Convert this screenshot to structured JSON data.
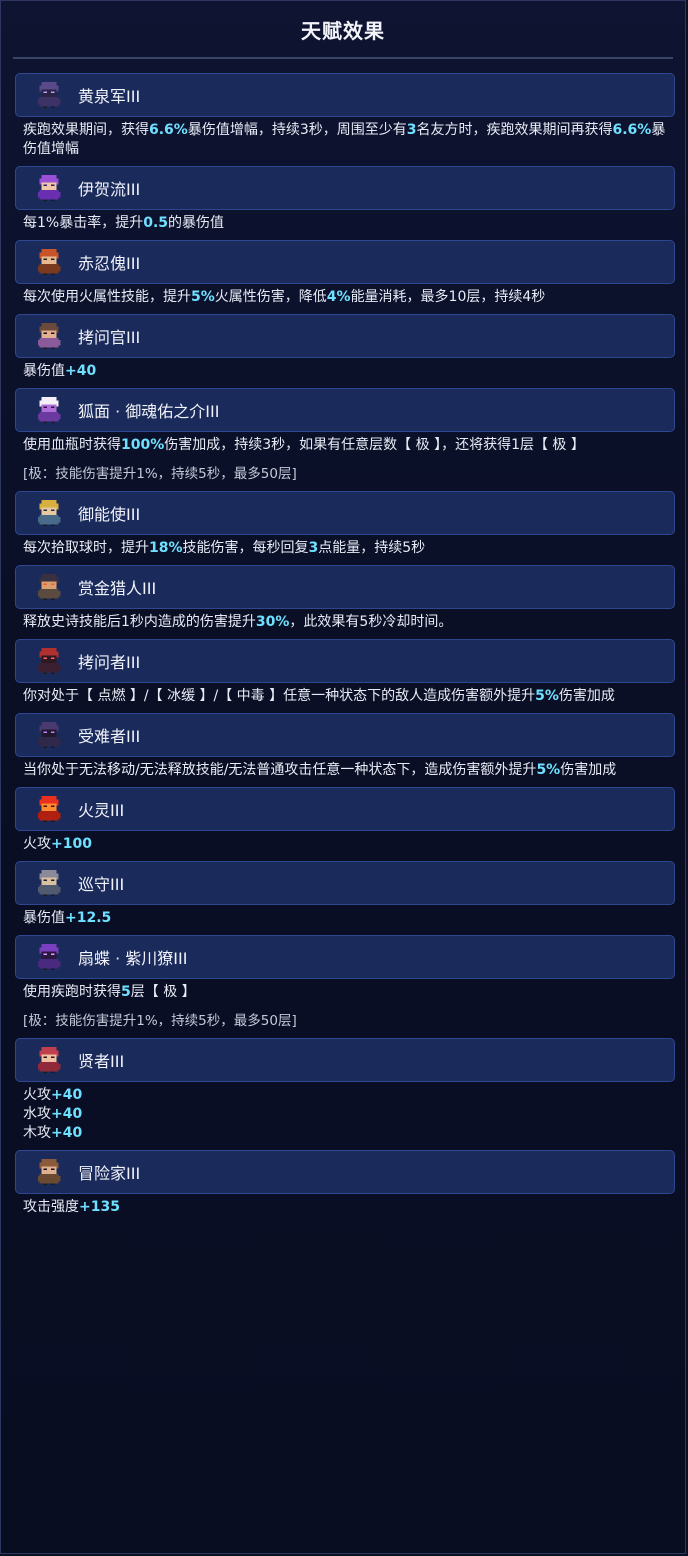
{
  "panel": {
    "title": "天赋效果"
  },
  "colors": {
    "highlight": "#6fe0ff",
    "header_bg": "#1a2a5a",
    "panel_bg": "#0b1024"
  },
  "entries": [
    {
      "name": "黄泉军III",
      "icon": "hooded-purple-ninja-icon",
      "desc": [
        "疾跑效果期间，获得",
        {
          "hl": "6.6%"
        },
        "暴伤值增幅，持续3秒，周围至少有",
        {
          "hl": "3"
        },
        "名友方时，疾跑效果期间再获得",
        {
          "hl": "6.6%"
        },
        "暴伤值增幅"
      ]
    },
    {
      "name": "伊贺流III",
      "icon": "purple-haired-ninja-icon",
      "desc": [
        "每1%暴击率，提升",
        {
          "hl": "0.5"
        },
        "的暴伤值"
      ]
    },
    {
      "name": "赤忍傀III",
      "icon": "red-puppet-ninja-icon",
      "desc": [
        "每次使用火属性技能，提升",
        {
          "hl": "5%"
        },
        "火属性伤害，降低",
        {
          "hl": "4%"
        },
        "能量消耗，最多10层，持续4秒"
      ]
    },
    {
      "name": "拷问官III",
      "icon": "interrogator-officer-icon",
      "desc": [
        "暴伤值",
        {
          "hl": "+40"
        }
      ]
    },
    {
      "name": "狐面 · 御魂佑之介III",
      "icon": "fox-mask-ninja-icon",
      "desc": [
        "使用血瓶时获得",
        {
          "hl": "100%"
        },
        "伤害加成，持续3秒，如果有任意层数【 极 】，还将获得1层【 极 】"
      ],
      "note": "[极：技能伤害提升1%，持续5秒，最多50层]"
    },
    {
      "name": "御能使III",
      "icon": "energy-mage-icon",
      "desc": [
        "每次拾取球时，提升",
        {
          "hl": "18%"
        },
        "技能伤害，每秒回复",
        {
          "hl": "3"
        },
        "点能量，持续5秒"
      ]
    },
    {
      "name": "赏金猎人III",
      "icon": "bounty-hunter-icon",
      "desc": [
        "释放史诗技能后1秒内造成的伤害提升",
        {
          "hl": "30%"
        },
        "，此效果有5秒冷却时间。"
      ]
    },
    {
      "name": "拷问者III",
      "icon": "red-hooded-torturer-icon",
      "desc": [
        "你对处于【 点燃 】/【 冰缓 】/【 中毒 】任意一种状态下的敌人造成伤害额外提升",
        {
          "hl": "5%"
        },
        "伤害加成"
      ]
    },
    {
      "name": "受难者III",
      "icon": "dark-spiky-sufferer-icon",
      "desc": [
        "当你处于无法移动/无法释放技能/无法普通攻击任意一种状态下，造成伤害额外提升",
        {
          "hl": "5%"
        },
        "伤害加成"
      ]
    },
    {
      "name": "火灵III",
      "icon": "fire-spirit-icon",
      "desc": [
        "火攻",
        {
          "hl": "+100"
        }
      ]
    },
    {
      "name": "巡守III",
      "icon": "patrol-guard-icon",
      "desc": [
        "暴伤值",
        {
          "hl": "+12.5"
        }
      ]
    },
    {
      "name": "扇蝶 · 紫川獠III",
      "icon": "purple-butterfly-ninja-icon",
      "desc": [
        "使用疾跑时获得",
        {
          "hl": "5"
        },
        "层【 极 】"
      ],
      "note": "[极：技能伤害提升1%，持续5秒，最多50层]"
    },
    {
      "name": "贤者III",
      "icon": "red-robed-sage-icon",
      "lines": [
        [
          "火攻",
          {
            "hl": "+40"
          }
        ],
        [
          "水攻",
          {
            "hl": "+40"
          }
        ],
        [
          "木攻",
          {
            "hl": "+40"
          }
        ]
      ]
    },
    {
      "name": "冒险家III",
      "icon": "adventurer-icon",
      "desc": [
        "攻击强度",
        {
          "hl": "+135"
        }
      ]
    }
  ]
}
